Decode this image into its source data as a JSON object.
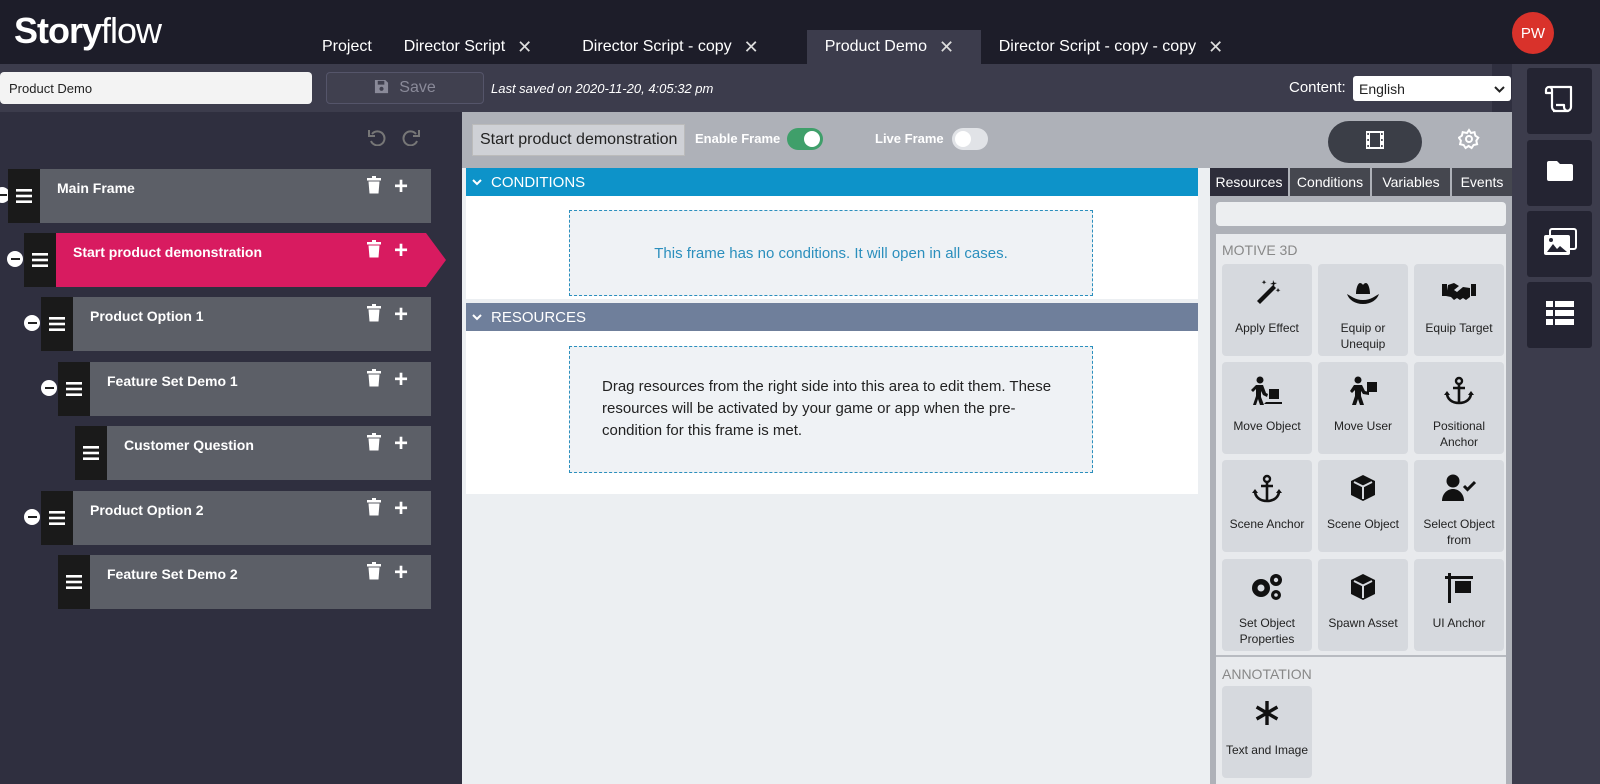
{
  "app": {
    "logo_bold": "Story",
    "logo_light": "flow"
  },
  "tabs": [
    {
      "label": "Project",
      "closable": false
    },
    {
      "label": "Director Script",
      "closable": true
    },
    {
      "label": "Director Script - copy",
      "closable": true
    },
    {
      "label": "Product Demo",
      "closable": true,
      "active": true
    },
    {
      "label": "Director Script - copy - copy",
      "closable": true
    }
  ],
  "close_glyph": "✕",
  "user": {
    "initials": "PW"
  },
  "toolbar": {
    "project_name": "Product Demo",
    "save_label": "Save",
    "last_saved": "Last saved on 2020-11-20, 4:05:32 pm",
    "content_label": "Content:",
    "language": "English"
  },
  "tree": {
    "nodes": [
      {
        "label": "Main Frame",
        "level": 0,
        "collapsible": true
      },
      {
        "label": "Start product demonstration",
        "level": 1,
        "collapsible": true,
        "active": true
      },
      {
        "label": "Product Option 1",
        "level": 2,
        "collapsible": true
      },
      {
        "label": "Feature Set Demo 1",
        "level": 3,
        "collapsible": true
      },
      {
        "label": "Customer Question",
        "level": 4,
        "collapsible": false
      },
      {
        "label": "Product Option 2",
        "level": 2,
        "collapsible": true
      },
      {
        "label": "Feature Set Demo 2",
        "level": 3,
        "collapsible": false
      }
    ]
  },
  "frame": {
    "title": "Start product demonstration",
    "enable_frame_label": "Enable Frame",
    "enable_frame_on": true,
    "live_frame_label": "Live Frame",
    "live_frame_on": false
  },
  "conditions": {
    "title": "CONDITIONS",
    "empty_text": "This frame has no conditions. It will open in all cases."
  },
  "resources": {
    "title": "RESOURCES",
    "empty_text": "Drag resources from the right side into this area to edit them. These resources will be activated by your game or app when the pre-condition for this frame is met."
  },
  "panel": {
    "tabs": [
      "Resources",
      "Conditions",
      "Variables",
      "Events"
    ],
    "active_tab": "Resources",
    "sections": [
      {
        "title": "MOTIVE 3D",
        "items": [
          {
            "label": "Apply Effect",
            "icon": "magic-wand-icon"
          },
          {
            "label": "Equip or Unequip",
            "icon": "hat-icon"
          },
          {
            "label": "Equip Target",
            "icon": "handshake-icon"
          },
          {
            "label": "Move Object",
            "icon": "person-dolly-icon"
          },
          {
            "label": "Move User",
            "icon": "person-box-icon"
          },
          {
            "label": "Positional Anchor",
            "icon": "anchor-icon"
          },
          {
            "label": "Scene Anchor",
            "icon": "anchor-icon"
          },
          {
            "label": "Scene Object",
            "icon": "cube-icon"
          },
          {
            "label": "Select Object from",
            "icon": "user-check-icon"
          },
          {
            "label": "Set Object Properties",
            "icon": "gears-icon"
          },
          {
            "label": "Spawn Asset",
            "icon": "cube-icon"
          },
          {
            "label": "UI Anchor",
            "icon": "sign-icon"
          }
        ]
      },
      {
        "title": "ANNOTATION",
        "items": [
          {
            "label": "Text and Image",
            "icon": "asterisk-icon"
          }
        ]
      }
    ]
  },
  "rail": [
    "script-scroll-icon",
    "folder-icon",
    "images-icon",
    "list-icon"
  ],
  "colors": {
    "accent_pink": "#d81b60",
    "conditions_blue": "#0d93c9",
    "resources_slate": "#6f7f9b",
    "toggle_green": "#3f9f6a",
    "avatar_red": "#d9322b"
  }
}
